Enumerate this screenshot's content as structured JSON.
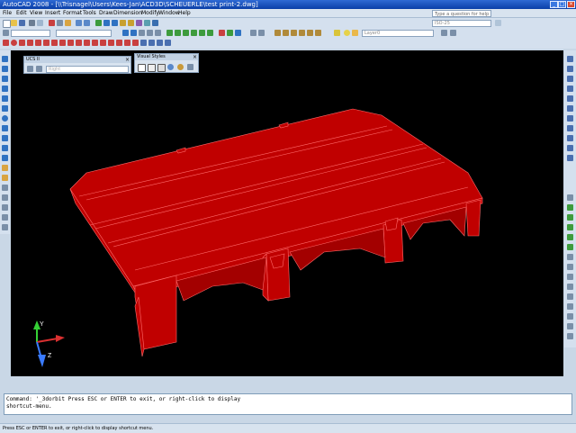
{
  "window": {
    "title": "AutoCAD 2008 - [\\\\Trisnagel\\Users\\Kees-Jan\\ACD3D\\SCHEUERLE\\test print-2.dwg]",
    "min": "_",
    "max": "□",
    "close": "×"
  },
  "menu": {
    "items": [
      "File",
      "Edit",
      "View",
      "Insert",
      "Format",
      "Tools",
      "Draw",
      "Dimension",
      "Modify",
      "Window",
      "Help"
    ]
  },
  "help_search": {
    "placeholder": "Type a question for help"
  },
  "toolbar": {
    "layer_combo": "Layer0",
    "style_combo": "ISO-25"
  },
  "panels": {
    "ucs2": {
      "title": "UCS II",
      "value": "Right"
    },
    "visual_styles": {
      "title": "Visual Styles"
    }
  },
  "ucs_icon": {
    "y": "Y",
    "z": "Z",
    "x": "X"
  },
  "command": {
    "line1": "Command: '_3dorbit Press ESC or ENTER to exit, or right-click to display",
    "line2": "shortcut-menu."
  },
  "status": {
    "text": "Press ESC or ENTER to exit, or right-click to display shortcut menu."
  },
  "colors": {
    "model": "#c00000",
    "model_edge": "#ff6b6b",
    "viewport_bg": "#000000",
    "title_bar": "#0a3fa8"
  }
}
